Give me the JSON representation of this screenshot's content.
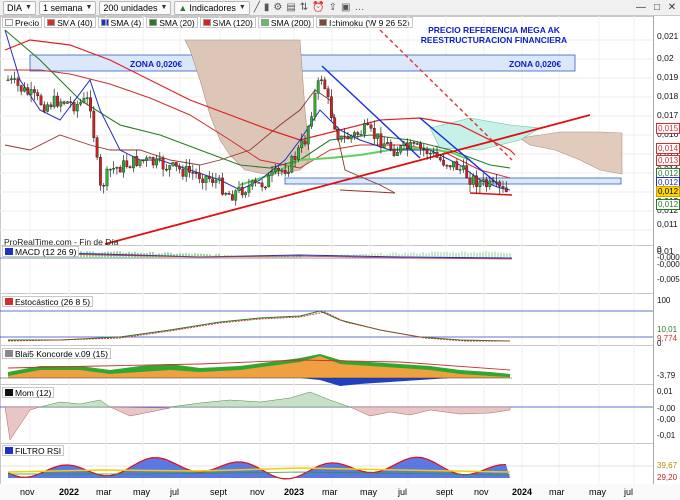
{
  "toolbar": {
    "symbol": "DIA",
    "period": "1 semana",
    "units": "200 unidades",
    "indicators": "Indicadores"
  },
  "legend": [
    {
      "label": "Precio",
      "color": "#ffffff"
    },
    {
      "label": "SMA (40)",
      "color": "#d03030"
    },
    {
      "label": "SMA (4)",
      "color": "#2030c0"
    },
    {
      "label": "SMA (20)",
      "color": "#2a7a2a"
    },
    {
      "label": "SMA (120)",
      "color": "#e02020"
    },
    {
      "label": "SMA (200)",
      "color": "#60c060"
    },
    {
      "label": "Ichimoku (W 9 26 52)",
      "color": "#7a4a3a"
    }
  ],
  "annotations": {
    "headline_line1": "PRECIO REFERENCIA MEGA AK",
    "headline_line2": "REESTRUCTURACION FINANCIERA",
    "zone_left": "ZONA 0,020€",
    "zone_right": "ZONA 0,020€",
    "credit": "ProRealTime.com - Fin de Día"
  },
  "price_axis": [
    "0,021",
    "0,02",
    "0,019",
    "0,018",
    "0,017",
    "0,016",
    "0,015",
    "0,014",
    "0,013",
    "0,012",
    "0,012",
    "0,011",
    "0,01"
  ],
  "price_tags": [
    {
      "text": "0,015",
      "color": "#d03030"
    },
    {
      "text": "0,014",
      "color": "#d03030"
    },
    {
      "text": "0,013",
      "color": "#d03030"
    },
    {
      "text": "0,012",
      "color": "#2a7a2a"
    },
    {
      "text": "0,012",
      "color": "#2030c0"
    },
    {
      "text": "0,012",
      "color": "#000000",
      "bg": "#ffd700"
    },
    {
      "text": "0,012",
      "color": "#2a7a2a"
    }
  ],
  "panels": {
    "macd": {
      "label": "MACD (12 26 9)",
      "axis": [
        "0",
        "-0,000",
        "-0,000",
        "-0,005"
      ]
    },
    "stoch": {
      "label": "Estocástico (26 8 5)",
      "axis": [
        "100",
        "10,01",
        "9,774",
        "0"
      ]
    },
    "koncorde": {
      "label": "Blai5 Koncorde v.09 (15)",
      "axis": [
        "-3,79"
      ]
    },
    "mom": {
      "label": "Mom (12)",
      "axis": [
        "0,01",
        "-0,00",
        "-0,00",
        "-0,01"
      ]
    },
    "rsi": {
      "label": "FILTRO RSI",
      "axis": [
        "39,67",
        "29,20"
      ]
    }
  },
  "x_axis": [
    "nov",
    "2022",
    "mar",
    "may",
    "jul",
    "sept",
    "nov",
    "2023",
    "mar",
    "may",
    "jul",
    "sept",
    "nov",
    "2024",
    "mar",
    "may",
    "jul"
  ],
  "colors": {
    "bull": "#30b030",
    "bear": "#d02020",
    "zone_fill": "#dbe8fb",
    "zone_border": "#3060c0"
  }
}
